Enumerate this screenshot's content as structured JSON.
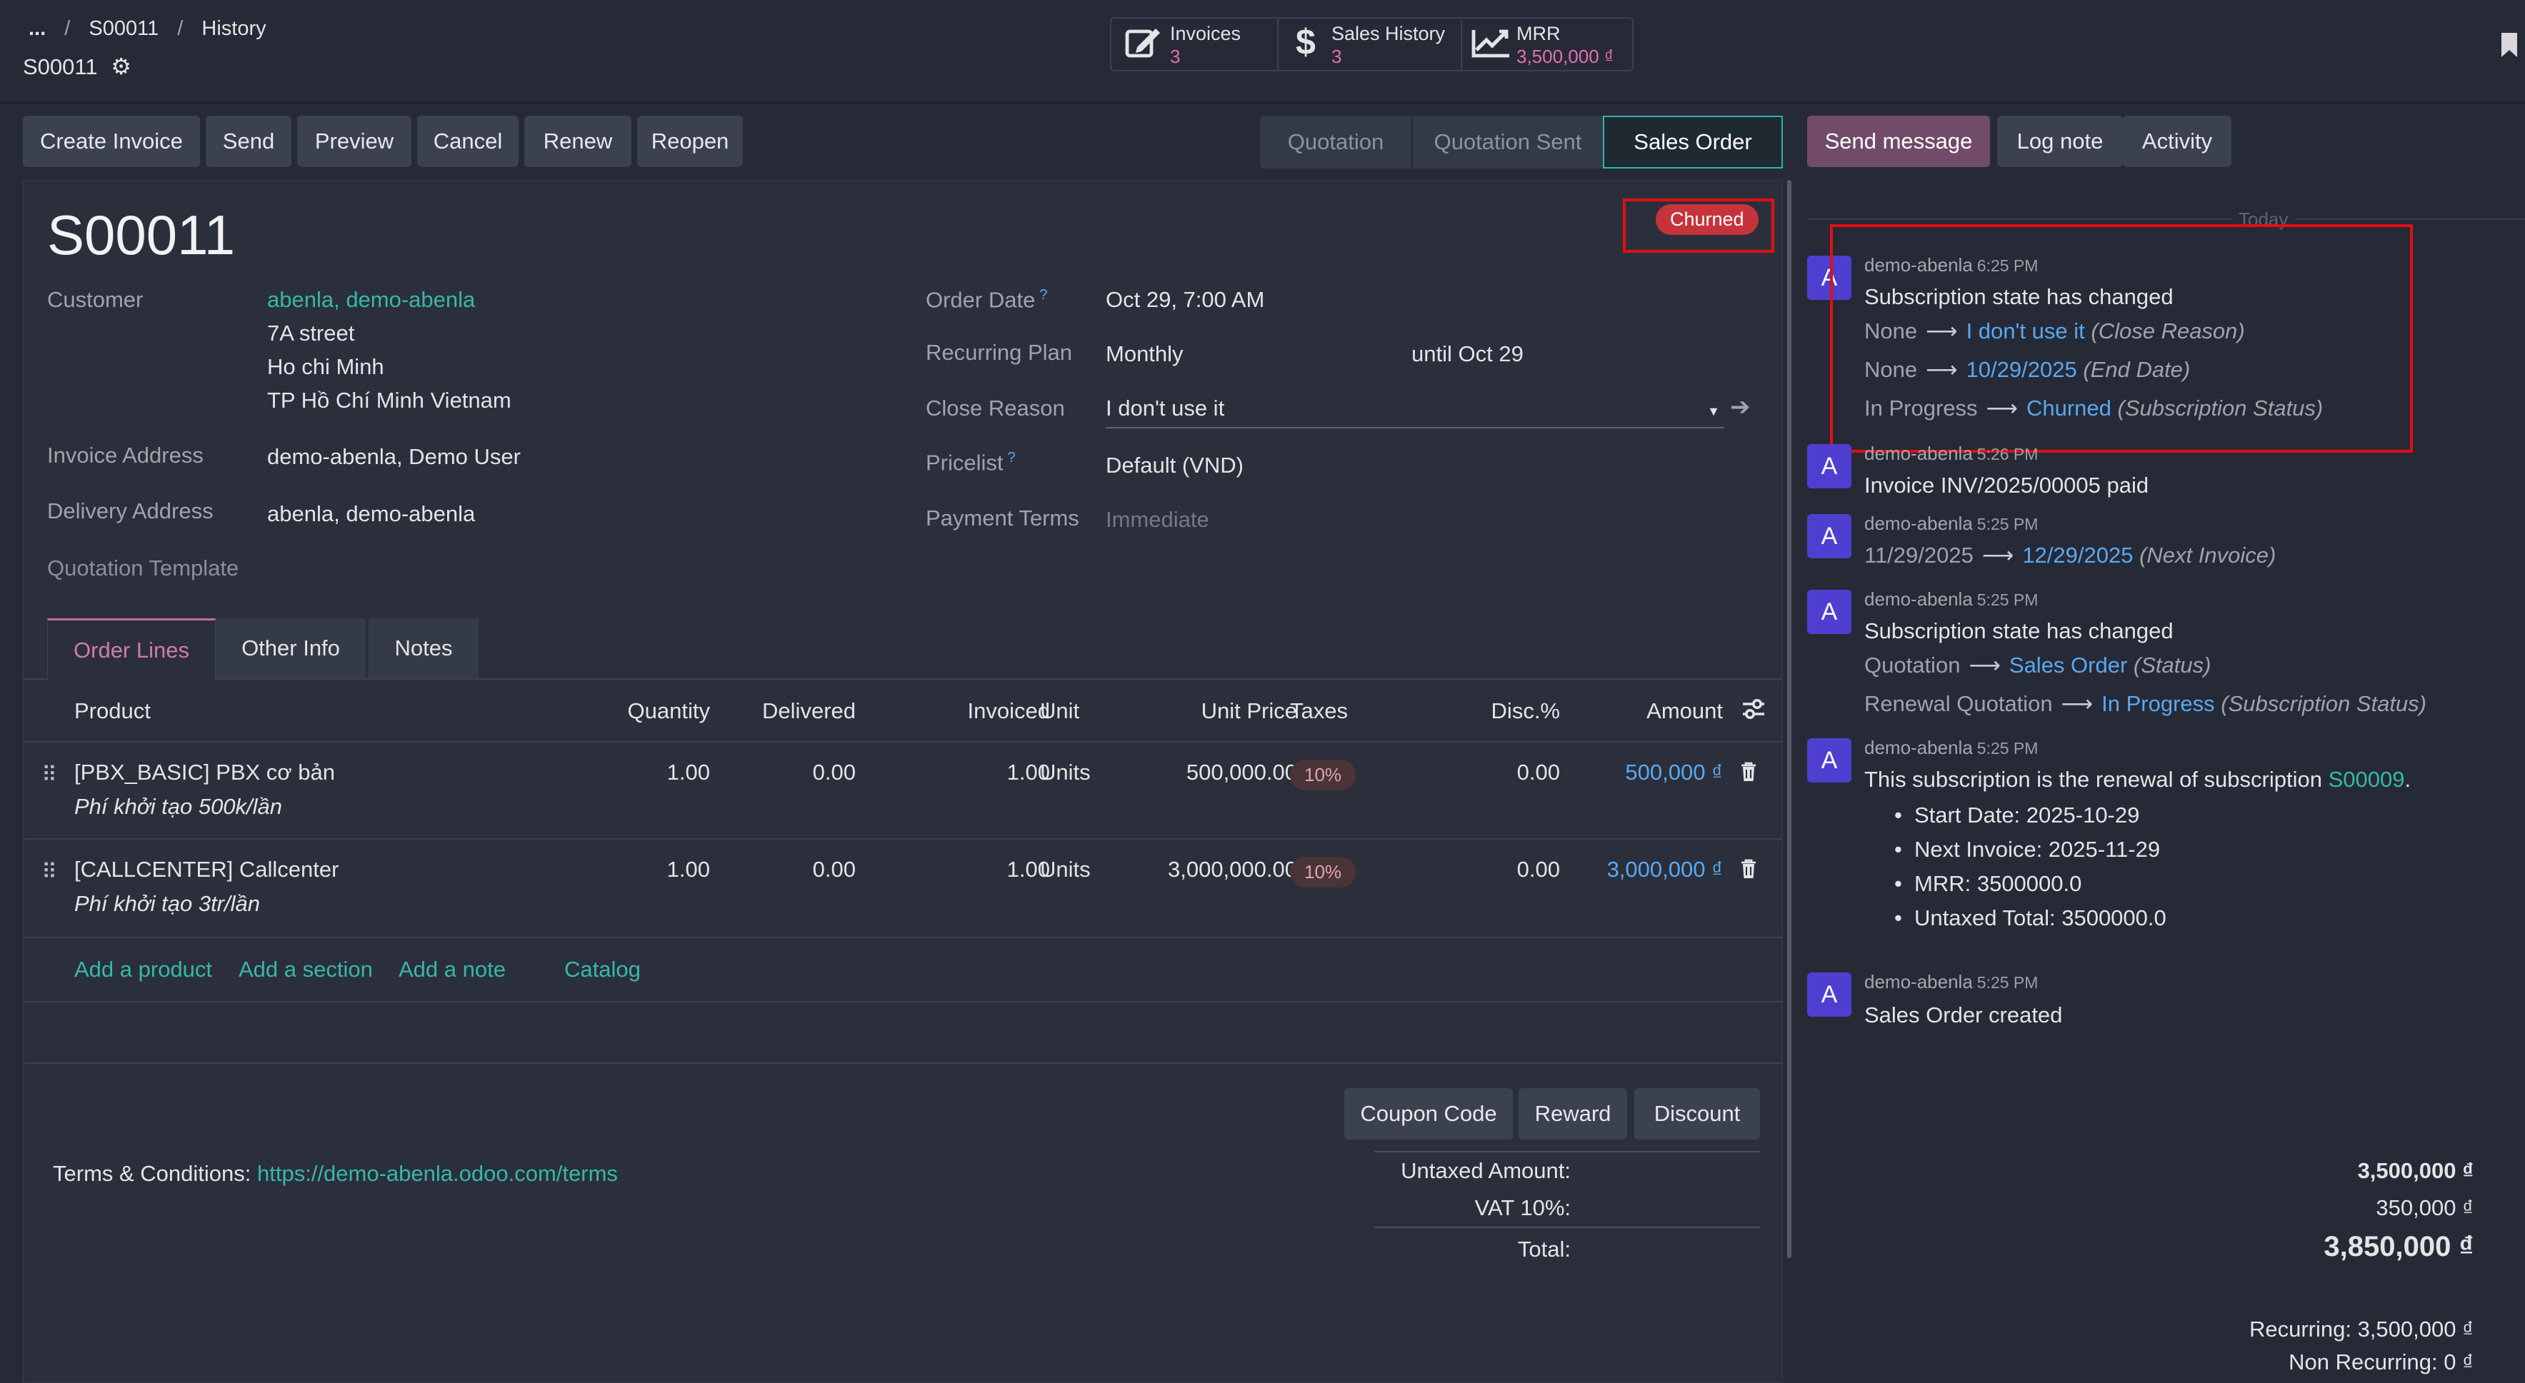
{
  "breadcrumb": {
    "more": "...",
    "parent": "S00011",
    "current": "History"
  },
  "record_name": "S00011",
  "stat_buttons": [
    {
      "label": "Invoices",
      "value": "3"
    },
    {
      "label": "Sales History",
      "value": "3"
    },
    {
      "label": "MRR",
      "value": "3,500,000 ₫"
    }
  ],
  "actions": [
    "Create Invoice",
    "Send",
    "Preview",
    "Cancel",
    "Renew",
    "Reopen"
  ],
  "stages": [
    "Quotation",
    "Quotation Sent",
    "Sales Order"
  ],
  "chatter_buttons": {
    "send": "Send message",
    "log": "Log note",
    "activity": "Activity"
  },
  "form": {
    "title": "S00011",
    "badge": "Churned",
    "customer_label": "Customer",
    "customer_name": "abenla, demo-abenla",
    "customer_addr1": "7A street",
    "customer_addr2": "Ho chi Minh",
    "customer_addr3": "TP Hồ Chí Minh Vietnam",
    "invoice_address_label": "Invoice Address",
    "invoice_address": "demo-abenla, Demo User",
    "delivery_address_label": "Delivery Address",
    "delivery_address": "abenla, demo-abenla",
    "quotation_template_label": "Quotation Template",
    "order_date_label": "Order Date",
    "order_date": "Oct 29, 7:00 AM",
    "recurring_plan_label": "Recurring Plan",
    "recurring_plan": "Monthly",
    "until": "until",
    "until_date": "Oct 29",
    "close_reason_label": "Close Reason",
    "close_reason": "I don't use it",
    "pricelist_label": "Pricelist",
    "pricelist": "Default (VND)",
    "payment_terms_label": "Payment Terms",
    "payment_terms_placeholder": "Immediate",
    "help_mark": "?"
  },
  "tabs": [
    "Order Lines",
    "Other Info",
    "Notes"
  ],
  "table": {
    "headers": {
      "product": "Product",
      "quantity": "Quantity",
      "delivered": "Delivered",
      "invoiced": "Invoiced",
      "unit": "Unit",
      "unit_price": "Unit Price",
      "taxes": "Taxes",
      "disc": "Disc.%",
      "amount": "Amount"
    },
    "rows": [
      {
        "product": "[PBX_BASIC] PBX cơ bản",
        "desc": "Phí khởi tạo 500k/lần",
        "quantity": "1.00",
        "delivered": "0.00",
        "invoiced": "1.00",
        "unit": "Units",
        "unit_price": "500,000.00",
        "tax": "10%",
        "disc": "0.00",
        "amount": "500,000 ₫"
      },
      {
        "product": "[CALLCENTER] Callcenter",
        "desc": "Phí khởi tạo 3tr/lần",
        "quantity": "1.00",
        "delivered": "0.00",
        "invoiced": "1.00",
        "unit": "Units",
        "unit_price": "3,000,000.00",
        "tax": "10%",
        "disc": "0.00",
        "amount": "3,000,000 ₫"
      }
    ],
    "add_product": "Add a product",
    "add_section": "Add a section",
    "add_note": "Add a note",
    "catalog": "Catalog"
  },
  "promo_buttons": [
    "Coupon Code",
    "Reward",
    "Discount"
  ],
  "terms": {
    "label": "Terms & Conditions:",
    "url": "https://demo-abenla.odoo.com/terms"
  },
  "totals": {
    "untaxed_label": "Untaxed Amount:",
    "untaxed": "3,500,000 ₫",
    "vat_label": "VAT 10%:",
    "vat": "350,000 ₫",
    "total_label": "Total:",
    "total": "3,850,000 ₫",
    "recurring": "Recurring: 3,500,000 ₫",
    "non_recurring": "Non Recurring: 0 ₫"
  },
  "chatter": {
    "today": "Today",
    "avatar_letter": "A",
    "messages": [
      {
        "author": "demo-abenla",
        "time": "6:25 PM",
        "body": "Subscription state has changed",
        "changes": [
          {
            "from": "None",
            "to": "I don't use it",
            "field": "(Close Reason)"
          },
          {
            "from": "None",
            "to": "10/29/2025",
            "field": "(End Date)"
          },
          {
            "from": "In Progress",
            "to": "Churned",
            "field": "(Subscription Status)"
          }
        ]
      },
      {
        "author": "demo-abenla",
        "time": "5:26 PM",
        "body": "Invoice INV/2025/00005 paid"
      },
      {
        "author": "demo-abenla",
        "time": "5:25 PM",
        "changes": [
          {
            "from": "11/29/2025",
            "to": "12/29/2025",
            "field": "(Next Invoice)"
          }
        ]
      },
      {
        "author": "demo-abenla",
        "time": "5:25 PM",
        "body": "Subscription state has changed",
        "changes": [
          {
            "from": "Quotation",
            "to": "Sales Order",
            "field": "(Status)"
          },
          {
            "from": "Renewal Quotation",
            "to": "In Progress",
            "field": "(Subscription Status)"
          }
        ]
      },
      {
        "author": "demo-abenla",
        "time": "5:25 PM",
        "body": "This subscription is the renewal of subscription",
        "link": "S00009",
        "tail": ".",
        "bullets": [
          "Start Date: 2025-10-29",
          "Next Invoice: 2025-11-29",
          "MRR: 3500000.0",
          "Untaxed Total: 3500000.0"
        ]
      },
      {
        "author": "demo-abenla",
        "time": "5:25 PM",
        "body": "Sales Order created"
      }
    ]
  },
  "colors": {
    "accent": "#36b8a8",
    "badge": "#c4343a",
    "highlight": "#e01010",
    "stage_active": "#2bb7a6",
    "primary_button": "#714b67"
  }
}
